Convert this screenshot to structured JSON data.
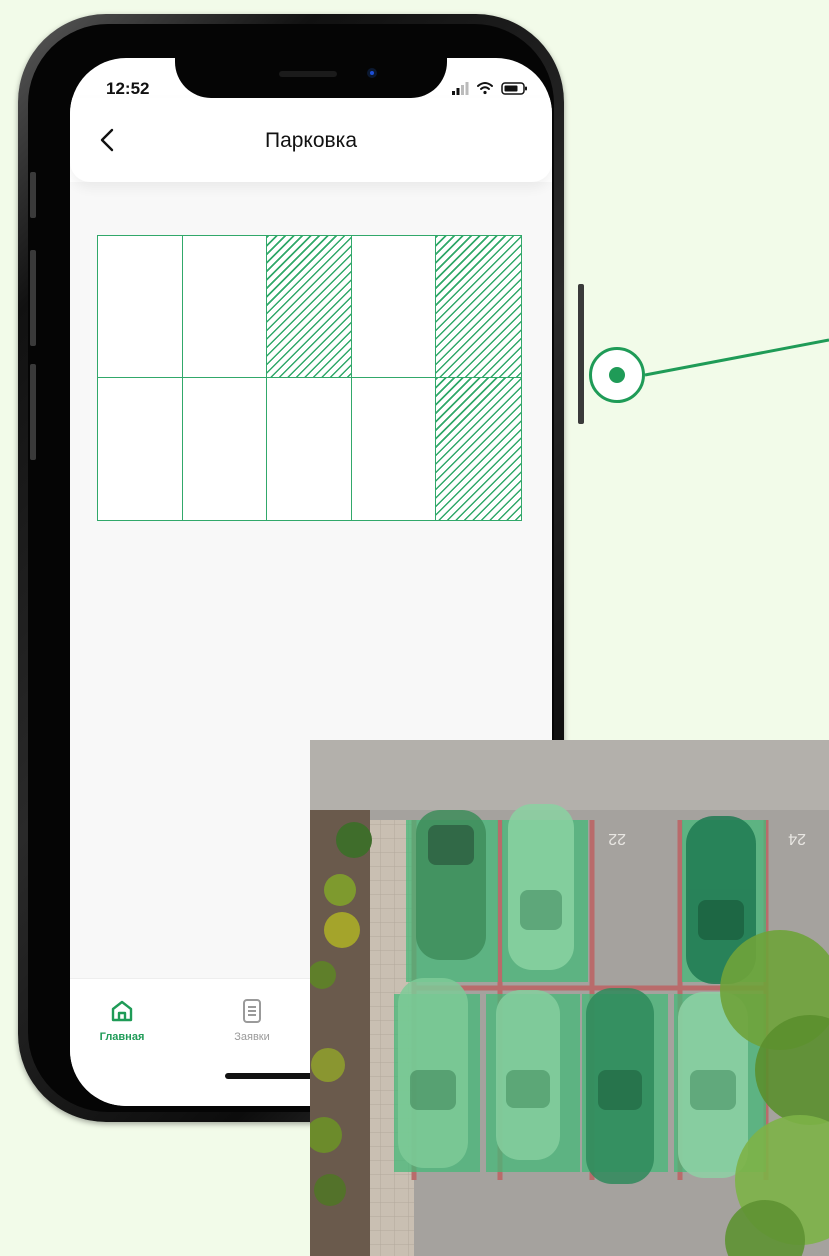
{
  "status_bar": {
    "time": "12:52"
  },
  "header": {
    "title": "Парковка"
  },
  "parking": {
    "rows": [
      [
        {
          "occupied": false
        },
        {
          "occupied": false
        },
        {
          "occupied": true
        },
        {
          "occupied": false
        },
        {
          "occupied": true
        }
      ],
      [
        {
          "occupied": false
        },
        {
          "occupied": false
        },
        {
          "occupied": false
        },
        {
          "occupied": false
        },
        {
          "occupied": true
        }
      ]
    ]
  },
  "tabbar": {
    "items": [
      {
        "label": "Главная",
        "icon": "home-icon",
        "active": true
      },
      {
        "label": "Заявки",
        "icon": "list-icon",
        "active": false
      }
    ]
  },
  "photo": {
    "space_labels": [
      "22",
      "24"
    ]
  },
  "colors": {
    "accent": "#1f9b57",
    "grid": "#31a86a",
    "background": "#f2fbe9"
  }
}
